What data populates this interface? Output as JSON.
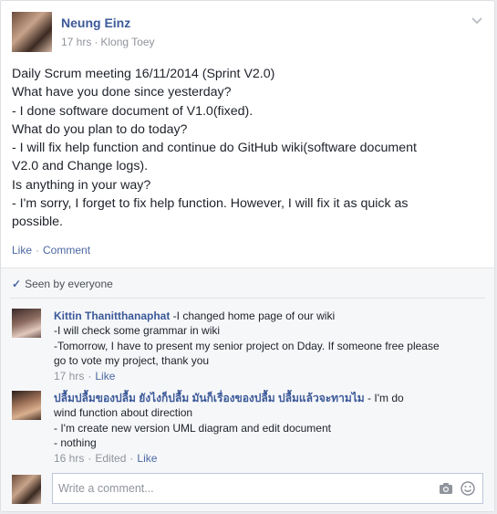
{
  "post": {
    "author": "Neung Einz",
    "time": "17 hrs",
    "location": "Klong Toey",
    "lines": [
      "Daily Scrum meeting 16/11/2014 (Sprint V2.0)",
      "What have you done since yesterday?",
      "- I done software document of V1.0(fixed).",
      "What do you plan to do today?",
      "- I will fix help function and continue do GitHub wiki(software document",
      "V2.0 and Change logs).",
      "Is anything in your way?",
      "- I'm sorry, I forget to fix help function. However, I will fix it as quick as",
      "possible."
    ],
    "like_label": "Like",
    "comment_label": "Comment"
  },
  "seen": {
    "text": "Seen by everyone"
  },
  "comments": [
    {
      "author": "Kittin Thanitthanaphat",
      "lines": [
        "-I changed home page of our wiki",
        "-I will check some grammar in wiki",
        "-Tomorrow, I have to present my senior project on Dday. If someone free please",
        "go to vote my project, thank you"
      ],
      "time": "17 hrs",
      "edited": "",
      "like_label": "Like"
    },
    {
      "author": "ปลื้มปลื้มของปลื้ม ยังไงก็ปลื้ม มันก็เรื่องของปลื้ม ปลื้มแล้วจะทามไม",
      "lines": [
        "- I'm do",
        "wind function about direction",
        "- I'm create new version UML diagram and edit document",
        "- nothing"
      ],
      "time": "16 hrs",
      "edited": "Edited",
      "like_label": "Like"
    }
  ],
  "composer": {
    "placeholder": "Write a comment..."
  },
  "icons": {
    "options": "chevron-down-icon",
    "seen": "check-icon",
    "camera": "camera-icon",
    "emoji": "smiley-icon"
  },
  "colors": {
    "link": "#3b5998",
    "muted": "#90949c",
    "feedback_bg": "#f6f7f9"
  }
}
